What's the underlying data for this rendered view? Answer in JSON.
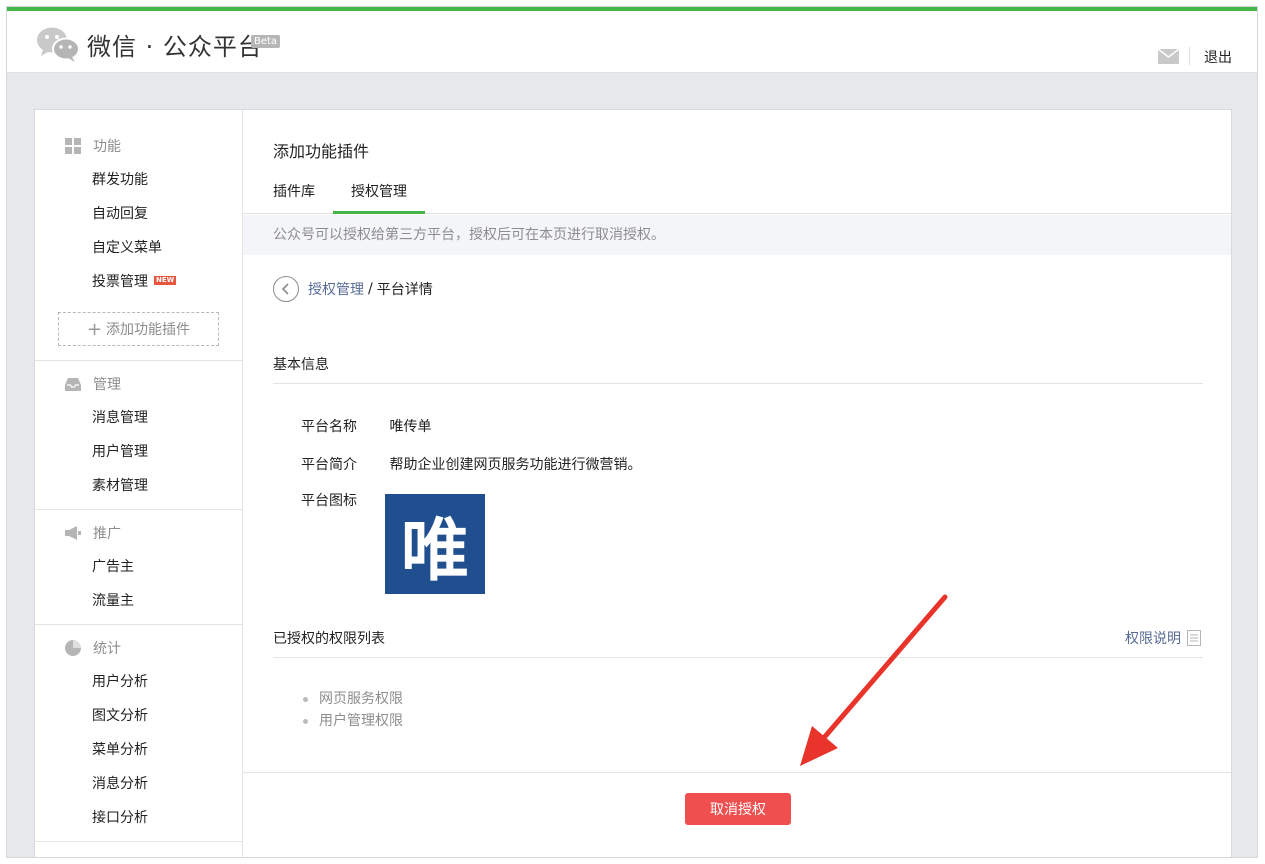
{
  "header": {
    "logo_text": "微信 · 公众平台",
    "beta": "Beta",
    "logout": "退出"
  },
  "sidebar": {
    "sections": [
      {
        "title": "功能",
        "items": [
          "群发功能",
          "自动回复",
          "自定义菜单",
          "投票管理"
        ],
        "new_badge": "NEW",
        "add_plugin": "添加功能插件"
      },
      {
        "title": "管理",
        "items": [
          "消息管理",
          "用户管理",
          "素材管理"
        ]
      },
      {
        "title": "推广",
        "items": [
          "广告主",
          "流量主"
        ]
      },
      {
        "title": "统计",
        "items": [
          "用户分析",
          "图文分析",
          "菜单分析",
          "消息分析",
          "接口分析"
        ]
      }
    ]
  },
  "main": {
    "title": "添加功能插件",
    "tabs": [
      "插件库",
      "授权管理"
    ],
    "notice": "公众号可以授权给第三方平台，授权后可在本页进行取消授权。",
    "breadcrumb": {
      "link": "授权管理",
      "sep": "/",
      "current": "平台详情"
    },
    "basic_info": {
      "heading": "基本信息",
      "name_label": "平台名称",
      "name_value": "唯传单",
      "desc_label": "平台简介",
      "desc_value": "帮助企业创建网页服务功能进行微营销。",
      "icon_label": "平台图标",
      "icon_glyph": "唯"
    },
    "permissions": {
      "heading": "已授权的权限列表",
      "explain_link": "权限说明",
      "items": [
        "网页服务权限",
        "用户管理权限"
      ]
    },
    "cancel_button": "取消授权"
  },
  "colors": {
    "brand_green": "#44b549",
    "danger": "#ef4f4f",
    "link": "#576b95",
    "icon_bg": "#1f4f8f"
  }
}
